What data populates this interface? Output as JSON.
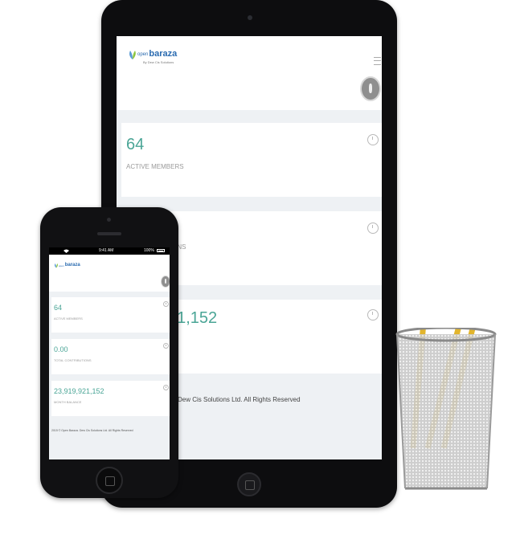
{
  "app": {
    "logo_lead": "open",
    "logo_main": "baraza",
    "logo_tag": "By Dew Cis Solutions"
  },
  "tablet": {
    "cards": [
      {
        "value": "64",
        "label": "ACTIVE MEMBERS"
      },
      {
        "value": "",
        "label": "TIONS"
      },
      {
        "value": "21,152",
        "label": ""
      }
    ],
    "footer": "Dew Cis Solutions Ltd. All Rights Reserved"
  },
  "phone": {
    "status": {
      "time": "9:41 AM",
      "battery": "100%"
    },
    "cards": [
      {
        "value": "64",
        "label": "ACTIVE MEMBERS"
      },
      {
        "value": "0.00",
        "label": "TOTAL CONTRIBUTIONS"
      },
      {
        "value": "23,919,921,152",
        "label": "MONTH BALANCE"
      }
    ],
    "footer": "2015 © Open Baraza. Dew Cis Solutions Ltd. All Rights Reserved"
  },
  "colors": {
    "accent_value": "#4aa596",
    "brand": "#2a6bb0",
    "background": "#eef1f4"
  },
  "icons": [
    "hamburger-icon",
    "user-avatar-icon",
    "clock-icon",
    "wifi-icon",
    "battery-icon",
    "home-button-icon"
  ]
}
